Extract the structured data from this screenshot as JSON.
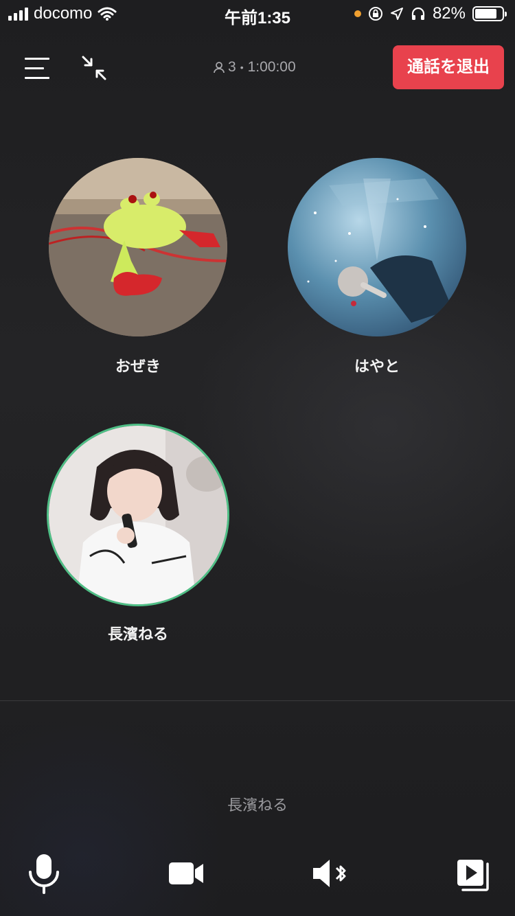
{
  "status_bar": {
    "carrier": "docomo",
    "time": "午前1:35",
    "battery_percent": "82%",
    "battery_level": 0.82
  },
  "header": {
    "participant_count": "3",
    "duration": "1:00:00",
    "exit_label": "通話を退出"
  },
  "participants": [
    {
      "name": "おぜき",
      "speaking": false,
      "avatar": "frog-plush-photo"
    },
    {
      "name": "はやと",
      "speaking": false,
      "avatar": "concert-singer-photo"
    },
    {
      "name": "長濱ねる",
      "speaking": true,
      "avatar": "singer-with-microphone-photo"
    }
  ],
  "active_speaker": {
    "name": "長濱ねる"
  },
  "controls": [
    {
      "icon": "microphone-icon"
    },
    {
      "icon": "video-camera-icon"
    },
    {
      "icon": "bluetooth-speaker-icon"
    },
    {
      "icon": "screen-share-icon"
    }
  ],
  "colors": {
    "exit_button": "#e8424d",
    "speaking_ring": "#4fbf86",
    "wave_teal": "#3aa9b9",
    "wave_green": "#4fc77f"
  }
}
